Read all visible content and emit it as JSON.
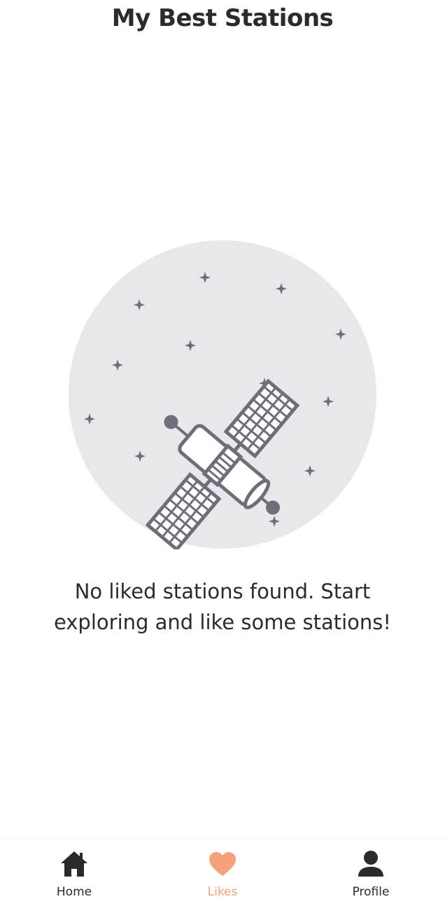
{
  "header": {
    "title": "My Best Stations"
  },
  "empty_state": {
    "illustration": "satellite-illustration",
    "message": "No liked stations found. Start exploring and like some stations!"
  },
  "bottom_nav": {
    "active_index": 1,
    "active_color": "#f4a27b",
    "items": [
      {
        "label": "Home",
        "icon": "home-icon"
      },
      {
        "label": "Likes",
        "icon": "heart-icon"
      },
      {
        "label": "Profile",
        "icon": "user-icon"
      }
    ]
  }
}
